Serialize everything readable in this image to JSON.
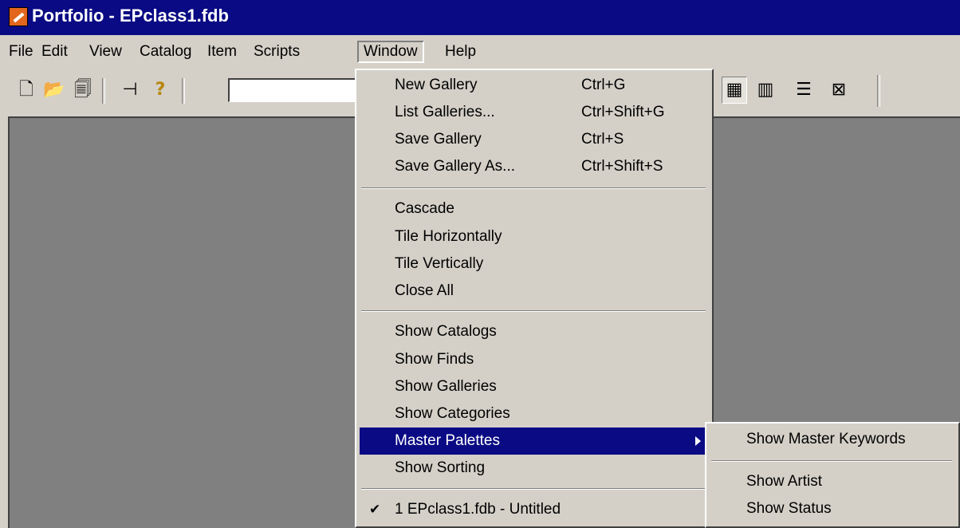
{
  "window": {
    "title": "Portfolio - EPclass1.fdb",
    "app_icon": "portfolio-app-icon"
  },
  "menubar": {
    "items": [
      "File",
      "Edit",
      "View",
      "Catalog",
      "Item",
      "Scripts",
      "Window",
      "Help"
    ],
    "active": "Window"
  },
  "toolbar": {
    "buttons": [
      {
        "icon": "new-document-icon",
        "glyph": "🗋"
      },
      {
        "icon": "open-folder-icon",
        "glyph": "📂"
      },
      {
        "icon": "open-catalog-icon",
        "glyph": "🗐"
      },
      {
        "icon": "pin-icon",
        "glyph": "⊣"
      },
      {
        "icon": "help-icon",
        "glyph": "?"
      }
    ],
    "search_value": "",
    "view_buttons": [
      {
        "icon": "thumbnail-view-icon",
        "glyph": "▦",
        "pressed": true
      },
      {
        "icon": "list-view-icon",
        "glyph": "▥",
        "pressed": false
      },
      {
        "icon": "record-view-icon",
        "glyph": "☰",
        "pressed": false
      },
      {
        "icon": "window-close-view-icon",
        "glyph": "⊠",
        "pressed": false
      }
    ]
  },
  "window_menu": {
    "group1": [
      {
        "label": "New Gallery",
        "shortcut": "Ctrl+G"
      },
      {
        "label": "List Galleries...",
        "shortcut": "Ctrl+Shift+G"
      },
      {
        "label": "Save Gallery",
        "shortcut": "Ctrl+S"
      },
      {
        "label": "Save Gallery As...",
        "shortcut": "Ctrl+Shift+S"
      }
    ],
    "group2": [
      {
        "label": "Cascade"
      },
      {
        "label": "Tile Horizontally"
      },
      {
        "label": "Tile Vertically"
      },
      {
        "label": "Close All"
      }
    ],
    "group3": [
      {
        "label": "Show Catalogs"
      },
      {
        "label": "Show Finds"
      },
      {
        "label": "Show Galleries"
      },
      {
        "label": "Show Categories"
      },
      {
        "label": "Master Palettes",
        "has_submenu": true,
        "highlighted": true
      },
      {
        "label": "Show Sorting"
      }
    ],
    "group4": [
      {
        "label": "1 EPclass1.fdb - Untitled",
        "checked": true
      }
    ]
  },
  "master_palettes_submenu": {
    "group1": [
      {
        "label": "Show Master Keywords"
      }
    ],
    "group2": [
      {
        "label": "Show Artist"
      },
      {
        "label": "Show Status"
      }
    ]
  },
  "colors": {
    "title_bar": "#0a0a84",
    "highlight": "#0a0a84",
    "chrome": "#d4d0c8",
    "workspace": "#808080"
  }
}
